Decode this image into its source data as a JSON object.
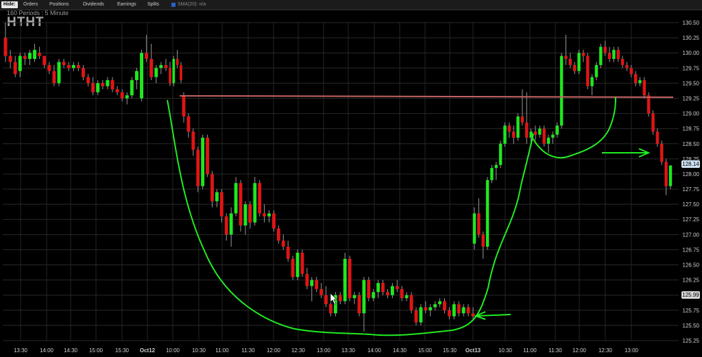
{
  "toolbar": {
    "hide_label": "Hide:",
    "items": [
      "Orders",
      "Positions",
      "Dividends",
      "Earnings",
      "Splits"
    ],
    "sma_label": "SMA(20): n/a"
  },
  "header": {
    "period_label": "160  Periods : 5 Minute",
    "symbol": "HTHT"
  },
  "badges": {
    "last_price": "128.14",
    "marker_price": "125.99"
  },
  "chart_data": {
    "type": "candlestick",
    "symbol": "HTHT",
    "interval": "5 Minute",
    "periods": 160,
    "ylim": [
      125.25,
      130.5
    ],
    "y_ticks": [
      "130.50",
      "130.25",
      "130.00",
      "129.75",
      "129.50",
      "129.25",
      "129.00",
      "128.75",
      "128.50",
      "128.25",
      "128.00",
      "127.75",
      "127.50",
      "127.25",
      "127.00",
      "126.75",
      "126.50",
      "126.25",
      "126.00",
      "125.75",
      "125.50",
      "125.25"
    ],
    "x_ticks": [
      "13:30",
      "14:00",
      "14:30",
      "15:00",
      "15:30",
      "Oct12",
      "10:00",
      "10:30",
      "11:00",
      "11:30",
      "12:00",
      "12:30",
      "13:00",
      "13:30",
      "14:00",
      "14:30",
      "15:00",
      "15:30",
      "Oct13",
      "10:30",
      "11:00",
      "11:30",
      "12:00",
      "12:30",
      "13:00"
    ],
    "resistance_level": 129.28,
    "series": [
      {
        "name": "day1",
        "values": [
          [
            130.25,
            130.5,
            129.85,
            129.95
          ],
          [
            129.95,
            130.05,
            129.75,
            129.85
          ],
          [
            129.85,
            129.95,
            129.6,
            129.65
          ],
          [
            129.7,
            130.0,
            129.6,
            129.95
          ],
          [
            129.95,
            130.0,
            129.8,
            129.9
          ],
          [
            129.9,
            130.05,
            129.8,
            130.0
          ],
          [
            129.9,
            130.15,
            129.85,
            130.05
          ],
          [
            130.0,
            130.1,
            129.9,
            129.95
          ],
          [
            129.95,
            129.95,
            129.75,
            129.8
          ],
          [
            129.8,
            129.85,
            129.65,
            129.7
          ],
          [
            129.7,
            129.8,
            129.45,
            129.5
          ],
          [
            129.5,
            129.9,
            129.45,
            129.85
          ],
          [
            129.85,
            129.9,
            129.75,
            129.8
          ],
          [
            129.8,
            129.85,
            129.7,
            129.75
          ],
          [
            129.75,
            129.85,
            129.7,
            129.8
          ],
          [
            129.8,
            129.85,
            129.7,
            129.75
          ],
          [
            129.75,
            129.8,
            129.55,
            129.6
          ],
          [
            129.6,
            129.65,
            129.45,
            129.5
          ],
          [
            129.5,
            129.6,
            129.3,
            129.35
          ],
          [
            129.35,
            129.55,
            129.3,
            129.5
          ],
          [
            129.5,
            129.55,
            129.4,
            129.45
          ],
          [
            129.45,
            129.6,
            129.4,
            129.55
          ],
          [
            129.55,
            129.6,
            129.35,
            129.4
          ],
          [
            129.4,
            129.45,
            129.3,
            129.35
          ],
          [
            129.35,
            129.4,
            129.2,
            129.25
          ],
          [
            129.25,
            129.35,
            129.15,
            129.3
          ],
          [
            129.3,
            129.6,
            129.25,
            129.55
          ],
          [
            129.55,
            129.75,
            129.4,
            129.7
          ],
          [
            129.25,
            130.05,
            129.2,
            130.0
          ],
          [
            130.0,
            130.3,
            129.85,
            129.9
          ],
          [
            129.9,
            130.15,
            129.55,
            129.6
          ],
          [
            129.6,
            129.8,
            129.5,
            129.75
          ],
          [
            129.75,
            129.85,
            129.65,
            129.8
          ],
          [
            129.8,
            129.9,
            129.7,
            129.75
          ]
        ]
      },
      {
        "name": "day1_afternoon",
        "values": [
          [
            129.75,
            129.85,
            129.45,
            129.5
          ],
          [
            129.5,
            129.95,
            129.45,
            129.9
          ],
          [
            129.9,
            130.05,
            129.75,
            129.8
          ],
          [
            129.8,
            129.85,
            129.5,
            129.55
          ]
        ]
      },
      {
        "name": "day2_open",
        "values": [
          [
            129.3,
            129.35,
            128.85,
            128.95
          ],
          [
            128.95,
            129.0,
            128.6,
            128.7
          ],
          [
            128.7,
            128.75,
            128.3,
            128.4
          ],
          [
            128.4,
            128.45,
            127.7,
            127.8
          ],
          [
            127.8,
            128.65,
            127.75,
            128.6
          ],
          [
            128.6,
            128.65,
            127.95,
            128.0
          ],
          [
            128.0,
            128.05,
            127.45,
            127.55
          ],
          [
            127.55,
            127.75,
            127.45,
            127.7
          ],
          [
            127.7,
            127.75,
            127.2,
            127.3
          ],
          [
            127.3,
            127.35,
            126.9,
            127.0
          ],
          [
            127.0,
            127.45,
            126.8,
            127.35
          ],
          [
            127.35,
            127.95,
            127.3,
            127.85
          ],
          [
            127.85,
            127.9,
            127.05,
            127.15
          ],
          [
            127.15,
            127.55,
            127.0,
            127.5
          ],
          [
            127.5,
            127.55,
            127.1,
            127.2
          ],
          [
            127.2,
            127.95,
            127.15,
            127.85
          ],
          [
            127.85,
            127.9,
            127.3,
            127.35
          ],
          [
            127.35,
            127.5,
            127.2,
            127.3
          ],
          [
            127.3,
            127.4,
            127.2,
            127.35
          ],
          [
            127.35,
            127.4,
            127.05,
            127.1
          ],
          [
            127.1,
            127.15,
            126.85,
            126.9
          ],
          [
            126.9,
            127.0,
            126.75,
            126.8
          ],
          [
            126.8,
            126.9,
            126.55,
            126.6
          ],
          [
            126.6,
            126.65,
            126.25,
            126.3
          ],
          [
            126.3,
            126.75,
            126.25,
            126.7
          ],
          [
            126.7,
            126.75,
            126.3,
            126.35
          ],
          [
            126.35,
            126.45,
            126.1,
            126.15
          ],
          [
            126.15,
            126.3,
            125.9,
            126.25
          ],
          [
            126.25,
            126.3,
            126.05,
            126.1
          ],
          [
            126.1,
            126.2,
            125.95,
            126.0
          ],
          [
            126.0,
            126.15,
            125.8,
            125.85
          ],
          [
            125.85,
            126.0,
            125.65,
            125.7
          ],
          [
            125.7,
            126.05,
            125.65,
            126.0
          ],
          [
            126.0,
            126.05,
            125.85,
            125.9
          ],
          [
            125.9,
            126.7,
            125.85,
            126.6
          ],
          [
            126.6,
            126.65,
            125.9,
            125.95
          ],
          [
            125.95,
            126.05,
            125.85,
            126.0
          ],
          [
            126.0,
            126.05,
            125.65,
            125.7
          ],
          [
            125.7,
            126.3,
            125.4,
            126.25
          ],
          [
            126.25,
            126.3,
            125.9,
            125.95
          ],
          [
            125.95,
            126.1,
            125.9,
            126.05
          ],
          [
            126.05,
            126.25,
            125.95,
            126.2
          ],
          [
            126.2,
            126.25,
            126.0,
            126.05
          ],
          [
            126.05,
            126.1,
            125.95,
            126.0
          ],
          [
            126.0,
            126.2,
            125.95,
            126.15
          ],
          [
            126.15,
            126.25,
            126.05,
            126.1
          ],
          [
            126.1,
            126.15,
            125.9,
            125.95
          ],
          [
            125.95,
            126.05,
            125.9,
            126.0
          ],
          [
            126.0,
            126.05,
            125.7,
            125.75
          ],
          [
            125.75,
            125.8,
            125.5,
            125.55
          ],
          [
            125.55,
            125.85,
            125.5,
            125.8
          ],
          [
            125.8,
            125.9,
            125.7,
            125.75
          ],
          [
            125.75,
            125.85,
            125.65,
            125.8
          ],
          [
            125.8,
            125.9,
            125.75,
            125.85
          ],
          [
            125.85,
            125.95,
            125.8,
            125.9
          ],
          [
            125.9,
            125.95,
            125.7,
            125.75
          ],
          [
            125.75,
            125.8,
            125.6,
            125.65
          ],
          [
            125.65,
            125.9,
            125.6,
            125.85
          ],
          [
            125.85,
            125.9,
            125.65,
            125.7
          ],
          [
            125.7,
            125.85,
            125.65,
            125.8
          ],
          [
            125.8,
            125.85,
            125.65,
            125.7
          ],
          [
            125.7,
            125.8,
            125.6,
            125.65
          ]
        ]
      },
      {
        "name": "day2_rally",
        "values": [
          [
            126.85,
            127.45,
            126.75,
            127.35
          ],
          [
            127.35,
            127.6,
            126.95,
            127.0
          ],
          [
            127.0,
            127.05,
            126.6,
            126.8
          ],
          [
            126.8,
            127.95,
            126.75,
            127.9
          ],
          [
            127.9,
            128.15,
            127.85,
            128.1
          ],
          [
            128.1,
            128.2,
            127.9,
            128.15
          ],
          [
            128.15,
            128.55,
            128.1,
            128.5
          ],
          [
            128.5,
            128.85,
            128.45,
            128.8
          ],
          [
            128.8,
            128.85,
            128.6,
            128.7
          ],
          [
            128.7,
            128.8,
            128.5,
            128.6
          ],
          [
            128.6,
            129.0,
            128.55,
            128.95
          ],
          [
            128.95,
            129.4,
            128.8,
            128.85
          ],
          [
            128.85,
            129.35,
            128.5,
            128.6
          ],
          [
            128.6,
            128.75,
            128.45,
            128.7
          ],
          [
            128.7,
            128.8,
            128.55,
            128.65
          ],
          [
            128.65,
            128.8,
            128.6,
            128.75
          ],
          [
            128.75,
            128.8,
            128.45,
            128.5
          ],
          [
            128.5,
            128.65,
            128.35,
            128.6
          ],
          [
            128.6,
            128.7,
            128.5,
            128.65
          ],
          [
            128.65,
            128.85,
            128.6,
            128.8
          ],
          [
            128.8,
            130.0,
            128.75,
            129.95
          ],
          [
            129.95,
            130.3,
            129.8,
            129.9
          ],
          [
            129.9,
            130.0,
            129.75,
            129.8
          ],
          [
            129.8,
            129.85,
            129.65,
            129.7
          ],
          [
            129.7,
            130.05,
            129.65,
            130.0
          ],
          [
            130.0,
            130.05,
            129.85,
            129.95
          ],
          [
            129.95,
            130.0,
            129.4,
            129.45
          ],
          [
            129.45,
            129.65,
            129.3,
            129.6
          ],
          [
            129.6,
            129.85,
            129.55,
            129.8
          ],
          [
            129.8,
            130.15,
            129.75,
            130.1
          ],
          [
            130.1,
            130.2,
            129.95,
            130.0
          ],
          [
            130.0,
            130.1,
            129.85,
            129.9
          ],
          [
            129.9,
            130.1,
            129.85,
            130.05
          ],
          [
            130.05,
            130.1,
            129.85,
            129.9
          ],
          [
            129.9,
            129.95,
            129.75,
            129.8
          ],
          [
            129.8,
            129.85,
            129.7,
            129.75
          ],
          [
            129.75,
            129.8,
            129.6,
            129.65
          ],
          [
            129.65,
            129.7,
            129.45,
            129.5
          ],
          [
            129.5,
            129.6,
            129.45,
            129.55
          ],
          [
            129.55,
            129.6,
            129.25,
            129.3
          ],
          [
            129.3,
            129.35,
            128.95,
            129.0
          ],
          [
            129.0,
            129.05,
            128.65,
            128.7
          ],
          [
            128.7,
            128.75,
            128.45,
            128.5
          ],
          [
            128.5,
            128.55,
            128.15,
            128.2
          ],
          [
            128.2,
            128.25,
            127.65,
            127.8
          ],
          [
            127.8,
            128.15,
            127.75,
            128.14
          ]
        ]
      }
    ],
    "annotations": [
      "U-shaped curve drawn around the selloff and recovery",
      "resistance line near 129.28",
      "green arrows pointing right near 125.7 and 128.35"
    ]
  }
}
